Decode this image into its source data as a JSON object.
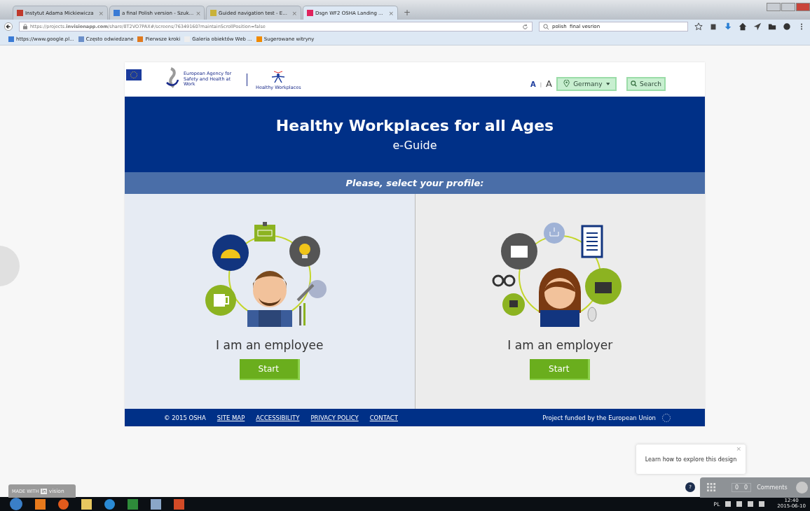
{
  "browser": {
    "tabs": [
      {
        "title": "Instytut Adama Mickiewicza",
        "close": "×",
        "selected": false
      },
      {
        "title": "a final Polish version - Szuk...",
        "close": "×",
        "selected": false
      },
      {
        "title": "Guided navigation test - E...",
        "close": "×",
        "selected": false
      },
      {
        "title": "Dsgn WF2 OSHA Landing ...",
        "close": "×",
        "selected": true
      }
    ],
    "new_tab": "+",
    "address": "https://projects.**invisionapp.com**/share/8T2VO7PAX#/screens/76349160?maintainScrollPosition=false",
    "search": {
      "value": "polish  final vesrion"
    },
    "bookmarks": [
      "https://www.google.pl...",
      "Często odwiedzane",
      "Pierwsze kroki",
      "Galeria obiektów Web ...",
      "Sugerowane witryny"
    ]
  },
  "page": {
    "header": {
      "agency_name": "European Agency for Safety and Health at Work",
      "campaign_name": "Healthy Workplaces",
      "font_small": "A",
      "font_separator": "|",
      "font_large": "A",
      "country": "Germany",
      "search_label": "Search"
    },
    "title": "Healthy Workplaces for all Ages",
    "subtitle": "e-Guide",
    "prompt": "Please, select your profile:",
    "profiles": [
      {
        "kind": "employee",
        "label": "I am an employee",
        "button": "Start"
      },
      {
        "kind": "employer",
        "label": "I am an employer",
        "button": "Start"
      }
    ],
    "footer": {
      "copyright": "© 2015 OSHA",
      "links": [
        "SITE MAP",
        "ACCESSIBILITY",
        "PRIVACY POLICY",
        "CONTACT"
      ],
      "funding": "Project funded by the European Union"
    }
  },
  "tooltip": {
    "text": "Learn how to explore this design",
    "close": "×"
  },
  "help_button": "?",
  "comments": {
    "counts": [
      "0",
      "0"
    ],
    "label": "Comments"
  },
  "badge": {
    "prefix": "MADE WITH",
    "brand_box": "in",
    "brand": "vision"
  },
  "taskbar": {
    "language": "PL",
    "time": "12:40",
    "date": "2015-06-10"
  }
}
